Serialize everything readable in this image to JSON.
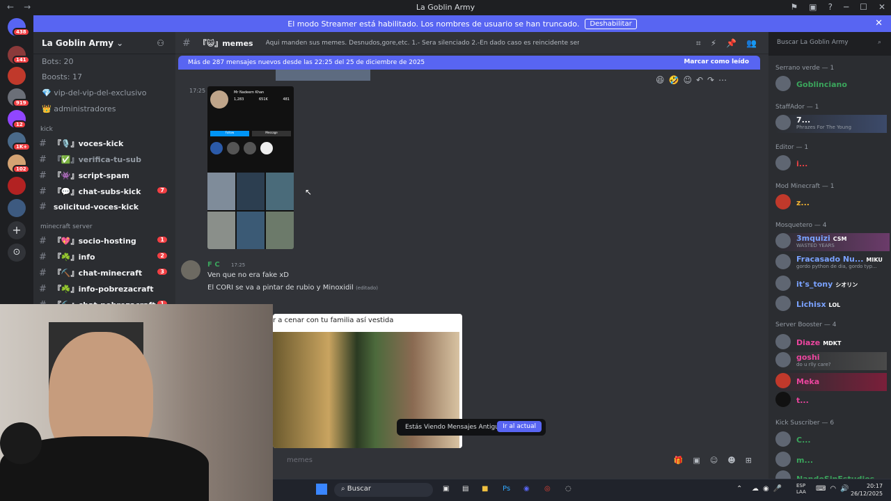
{
  "window": {
    "title": "La Goblin Army"
  },
  "streamer_banner": {
    "text": "El modo Streamer está habilitado. Los nombres de usuario se han truncado.",
    "button": "Deshabilitar"
  },
  "guild_badges": [
    "438",
    "141",
    "919",
    "12",
    "1K+",
    "102"
  ],
  "server": {
    "name": "La Goblin Army",
    "stats": [
      "Bots: 20",
      "Boosts: 17"
    ],
    "pinned": [
      "vip-del-vip-del-exclusivo",
      "administradores"
    ],
    "categories": [
      {
        "name": "kick",
        "channels": [
          {
            "name": "『🎙️』voces-kick",
            "badge": ""
          },
          {
            "name": "『✅』verifica-tu-sub",
            "badge": ""
          },
          {
            "name": "『👾』script-spam",
            "badge": ""
          },
          {
            "name": "『💬』chat-subs-kick",
            "badge": "7"
          },
          {
            "name": "solicitud-voces-kick",
            "badge": ""
          }
        ]
      },
      {
        "name": "minecraft server",
        "channels": [
          {
            "name": "『💖』socio-hosting",
            "badge": "1"
          },
          {
            "name": "『☘️』info",
            "badge": "2"
          },
          {
            "name": "『⛏️』chat-minecraft",
            "badge": "3"
          },
          {
            "name": "『☘️』info-pobrezacraft",
            "badge": ""
          },
          {
            "name": "『⛏️』chat-pobrezacraft",
            "badge": "1"
          }
        ]
      }
    ]
  },
  "channel": {
    "name": "『😺』memes",
    "topic": "Aqui manden sus memes. Desnudos,gore,etc. 1.- Sera silenciado 2.-En dado caso es reincidente sera baneado"
  },
  "search_placeholder": "Buscar La Goblin Army",
  "new_messages": {
    "text": "Más de 287 mensajes nuevos desde las 22:25 del 25 de diciembre de 2025",
    "mark": "Marcar como leído"
  },
  "messages": [
    {
      "time": "17:25",
      "author": "",
      "lines": []
    },
    {
      "time": "17:25",
      "author": "F C",
      "lines": [
        "Ven que no era fake xD",
        "El CORI se va a pintar de rubio y Minoxidil"
      ],
      "edited": "(editado)"
    }
  ],
  "instagram": {
    "name": "Mr Nadeem Khan",
    "posts": "1,283",
    "followers": "651K",
    "following": "481",
    "follow": "Follow",
    "message": "Message"
  },
  "embed_caption": "r a cenar con tu familia así vestida",
  "old_messages": {
    "text": "Estás Viendo Mensajes Antiguos",
    "button": "Ir al actual"
  },
  "composer_placeholder": "memes",
  "members": [
    {
      "role": "Serrano verde — 1",
      "users": [
        {
          "name": "Goblinciano",
          "sub": "",
          "color": "#3ba55c",
          "tag": ""
        }
      ]
    },
    {
      "role": "StaffAdor — 1",
      "users": [
        {
          "name": "7...",
          "sub": "Phrazes For The Young",
          "color": "#f2f3f5",
          "tag": ""
        }
      ]
    },
    {
      "role": "Editor — 1",
      "users": [
        {
          "name": "i...",
          "sub": "",
          "color": "#ed4245",
          "tag": ""
        }
      ]
    },
    {
      "role": "Mod Minecraft — 1",
      "users": [
        {
          "name": "z...",
          "sub": "",
          "color": "#f0b232",
          "tag": ""
        }
      ]
    },
    {
      "role": "Mosquetero — 4",
      "users": [
        {
          "name": "3mquizi",
          "sub": "WASTED YEARS",
          "color": "#7aa2ff",
          "tag": "CSM"
        },
        {
          "name": "Fracasado Nu...",
          "sub": "gordo python de dia, gordo typ...",
          "color": "#7aa2ff",
          "tag": "MIKU"
        },
        {
          "name": "it's_tony",
          "sub": "",
          "color": "#7aa2ff",
          "tag": "シオリン"
        },
        {
          "name": "Lichisx",
          "sub": "",
          "color": "#7aa2ff",
          "tag": "LOL"
        }
      ]
    },
    {
      "role": "Server Booster — 4",
      "users": [
        {
          "name": "Diaze",
          "sub": "",
          "color": "#eb459e",
          "tag": "MDKT"
        },
        {
          "name": "goshi",
          "sub": "do u rlly care?",
          "color": "#eb459e",
          "tag": ""
        },
        {
          "name": "Meka",
          "sub": "",
          "color": "#eb459e",
          "tag": ""
        },
        {
          "name": "t...",
          "sub": "",
          "color": "#eb459e",
          "tag": ""
        }
      ]
    },
    {
      "role": "Kick Suscriber — 6",
      "users": [
        {
          "name": "C...",
          "sub": "",
          "color": "#3ba55c",
          "tag": ""
        },
        {
          "name": "m...",
          "sub": "",
          "color": "#3ba55c",
          "tag": ""
        },
        {
          "name": "NandoSinEstudios",
          "sub": "",
          "color": "#3ba55c",
          "tag": ""
        }
      ]
    }
  ],
  "taskbar": {
    "search": "Buscar",
    "lang": "ESP",
    "lang2": "LAA",
    "time": "20:17",
    "date": "26/12/2025"
  }
}
